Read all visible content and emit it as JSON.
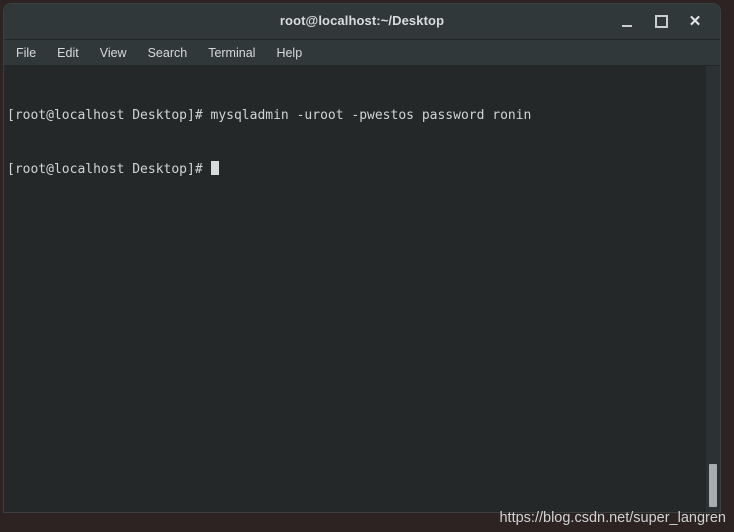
{
  "window": {
    "title": "root@localhost:~/Desktop",
    "controls": [
      {
        "name": "minimize",
        "label": "_"
      },
      {
        "name": "maximize",
        "label": "□"
      },
      {
        "name": "close",
        "label": "✕"
      }
    ]
  },
  "menu": {
    "items": [
      {
        "label": "File"
      },
      {
        "label": "Edit"
      },
      {
        "label": "View"
      },
      {
        "label": "Search"
      },
      {
        "label": "Terminal"
      },
      {
        "label": "Help"
      }
    ]
  },
  "terminal": {
    "lines": [
      "[root@localhost Desktop]# mysqladmin -uroot -pwestos password ronin",
      "[root@localhost Desktop]# "
    ],
    "prompt": "[root@localhost Desktop]#",
    "command": "mysqladmin -uroot -pwestos password ronin",
    "cursor_visible": true
  },
  "scrollbar": {
    "thumb_position": "bottom"
  },
  "watermark": {
    "text": "https://blog.csdn.net/super_langren"
  },
  "colors": {
    "desktop_bg": "#2d2323",
    "titlebar_bg": "#31383a",
    "terminal_bg": "#242829",
    "terminal_fg": "#d0d4d5",
    "scrollbar_thumb": "#a8aeb0"
  }
}
